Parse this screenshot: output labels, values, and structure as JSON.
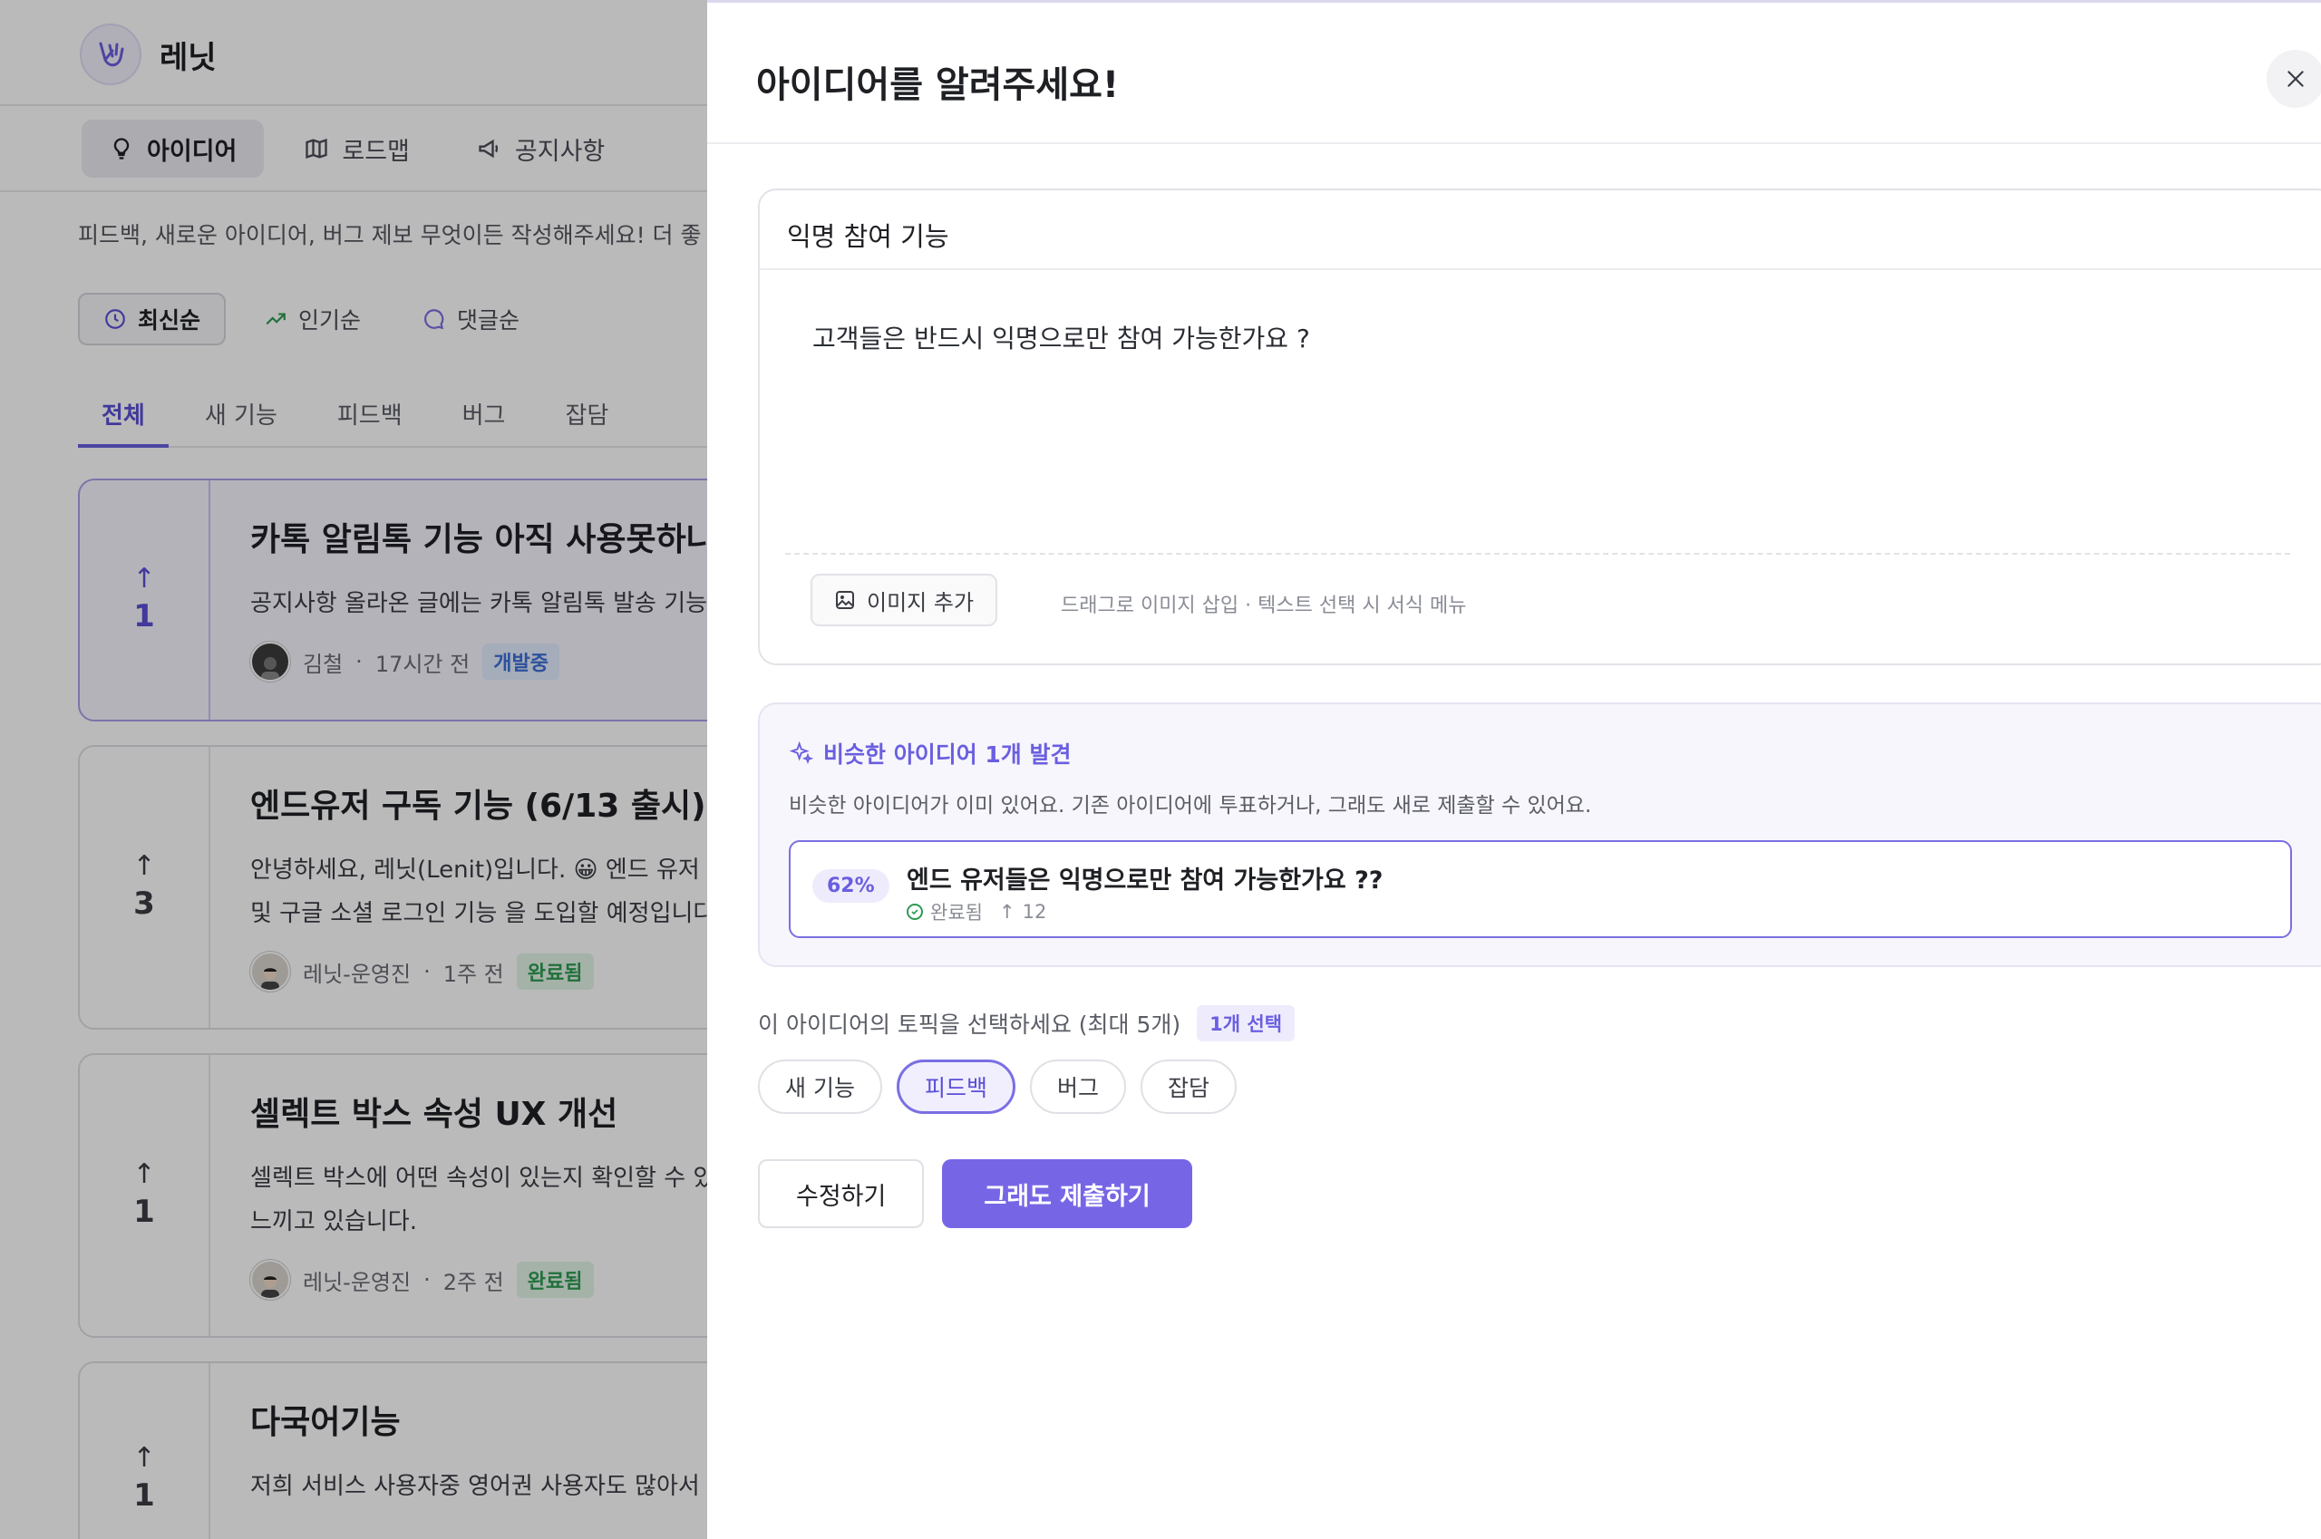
{
  "app": {
    "brand": "레닛",
    "nav_tabs": [
      {
        "label": "아이디어",
        "icon": "lightbulb-icon"
      },
      {
        "label": "로드맵",
        "icon": "map-icon"
      },
      {
        "label": "공지사항",
        "icon": "megaphone-icon"
      }
    ],
    "intro": "피드백, 새로운 아이디어, 버그 제보 무엇이든 작성해주세요! 더 좋",
    "sort": [
      {
        "label": "최신순",
        "icon": "clock-icon"
      },
      {
        "label": "인기순",
        "icon": "trending-icon"
      },
      {
        "label": "댓글순",
        "icon": "comment-icon"
      }
    ],
    "categories": [
      "전체",
      "새 기능",
      "피드백",
      "버그",
      "잡담"
    ],
    "posts": [
      {
        "votes": "1",
        "title": "카톡 알림톡 기능 아직 사용못하나요",
        "text": [
          "공지사항 올라온 글에는 카톡 알림톡 발송 기능"
        ],
        "author": "김철",
        "time": "17시간 전",
        "status": "개발중"
      },
      {
        "votes": "3",
        "title": "엔드유저 구독 기능 (6/13 출시)",
        "text": [
          "안녕하세요, 레닛(Lenit)입니다. 😀 엔드 유저",
          "및 구글 소셜 로그인 기능 을 도입할 예정입니다"
        ],
        "author": "레닛-운영진",
        "time": "1주 전",
        "status": "완료됨"
      },
      {
        "votes": "1",
        "title": "셀렉트 박스 속성 UX 개선",
        "text": [
          "셀렉트 박스에 어떤 속성이 있는지 확인할 수 있",
          "느끼고 있습니다."
        ],
        "author": "레닛-운영진",
        "time": "2주 전",
        "status": "완료됨"
      },
      {
        "votes": "1",
        "title": "다국어기능",
        "text": [
          "저희 서비스 사용자중 영어권 사용자도 많아서"
        ],
        "author": "",
        "time": "",
        "status": ""
      }
    ]
  },
  "panel": {
    "title": "아이디어를 알려주세요!",
    "editor": {
      "title": "익명 참여 기능",
      "body": "고객들은 반드시 익명으로만 참여 가능한가요 ?",
      "image_button": "이미지 추가",
      "hint": "드래그로 이미지 삽입 · 텍스트 선택 시 서식 메뉴"
    },
    "similar": {
      "heading": "비슷한 아이디어 1개 발견",
      "description": "비슷한 아이디어가 이미 있어요. 기존 아이디어에 투표하거나, 그래도 새로 제출할 수 있어요.",
      "item": {
        "match": "62%",
        "title": "엔드 유저들은 익명으로만 참여 가능한가요 ??",
        "status": "완료됨",
        "votes": "12"
      }
    },
    "topics": {
      "label": "이 아이디어의 토픽을 선택하세요 (최대 5개)",
      "count": "1개 선택",
      "options": [
        {
          "label": "새 기능",
          "selected": false
        },
        {
          "label": "피드백",
          "selected": true
        },
        {
          "label": "버그",
          "selected": false
        },
        {
          "label": "잡담",
          "selected": false
        }
      ]
    },
    "buttons": {
      "edit": "수정하기",
      "submit": "그래도 제출하기"
    }
  },
  "colors": {
    "accent": "#7666e6",
    "accent_text": "#6a5fe0",
    "done": "#2e9a52",
    "dev": "#3c6fd8"
  }
}
